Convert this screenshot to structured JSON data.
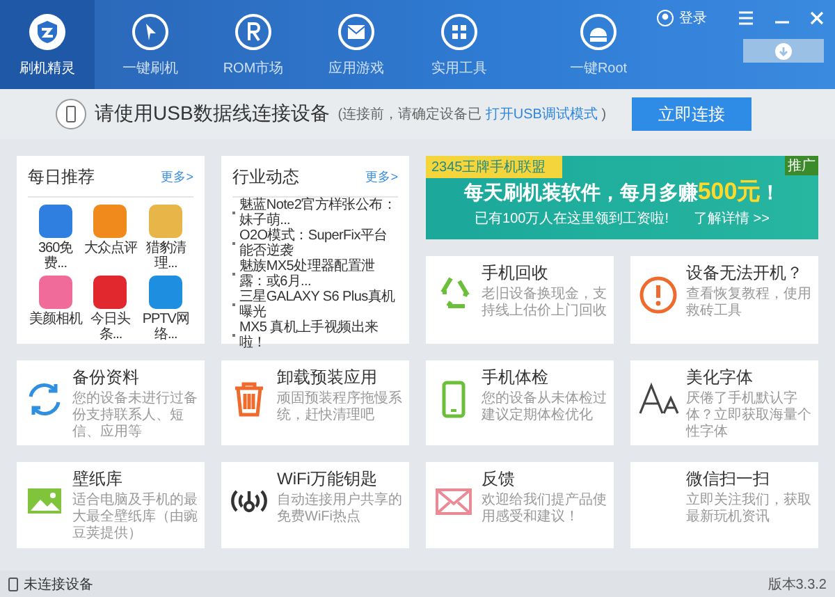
{
  "window": {
    "nav": [
      {
        "kind": "logo",
        "label": "刷机精灵",
        "selected": true
      },
      {
        "kind": "flash",
        "label": "一键刷机",
        "selected": false
      },
      {
        "kind": "rom",
        "label": "ROM市场",
        "selected": false
      },
      {
        "kind": "apps",
        "label": "应用游戏",
        "selected": false
      },
      {
        "kind": "tools",
        "label": "实用工具",
        "selected": false
      },
      {
        "kind": "root",
        "label": "一键Root",
        "selected": false
      }
    ],
    "login": "登录"
  },
  "connect_bar": {
    "title": "请使用USB数据线连接设备",
    "hint_prefix": "(连接前，请确定设备已",
    "hint_link": "打开USB调试模式",
    "hint_suffix": ")",
    "button": "立即连接"
  },
  "daily": {
    "title": "每日推荐",
    "more": "更多>",
    "apps": [
      {
        "name": "360免费...",
        "color": "#2f7fe0"
      },
      {
        "name": "大众点评",
        "color": "#f08a1c"
      },
      {
        "name": "猎豹清理...",
        "color": "#e8b548"
      },
      {
        "name": "美颜相机",
        "color": "#f06a9a"
      },
      {
        "name": "今日头条...",
        "color": "#e0282e"
      },
      {
        "name": "PPTV网络...",
        "color": "#1e8fe0"
      }
    ]
  },
  "news": {
    "title": "行业动态",
    "more": "更多>",
    "items": [
      "魅蓝Note2官方样张公布：妹子萌...",
      "O2O模式：SuperFix平台能否逆袭",
      "魅族MX5处理器配置泄露：或6月...",
      "三星GALAXY S6 Plus真机曝光",
      "MX5 真机上手视频出来啦！"
    ]
  },
  "ad": {
    "tag": "2345王牌手机联盟",
    "badge": "推广",
    "headline_prefix": "每天刷机装软件，每月多赚",
    "headline_highlight": "500元",
    "headline_suffix": "！",
    "sub": "已有100万人在这里领到工资啦!",
    "link": "了解详情 >>"
  },
  "tools": [
    {
      "kind": "recycle",
      "title": "手机回收",
      "desc": "老旧设备换现金，支持线上估价上门回收"
    },
    {
      "kind": "alert",
      "title": "设备无法开机？",
      "desc": "查看恢复教程，使用救砖工具"
    },
    {
      "kind": "backup",
      "title": "备份资料",
      "desc": "您的设备未进行过备份支持联系人、短信、应用等"
    },
    {
      "kind": "trash",
      "title": "卸载预装应用",
      "desc": "顽固预装程序拖慢系统，赶快清理吧"
    },
    {
      "kind": "phone",
      "title": "手机体检",
      "desc": "您的设备从未体检过建议定期体检优化"
    },
    {
      "kind": "font",
      "title": "美化字体",
      "desc": "厌倦了手机默认字体？立即获取海量个性字体"
    },
    {
      "kind": "wallpaper",
      "title": "壁纸库",
      "desc": "适合电脑及手机的最大最全壁纸库（由豌豆荚提供）"
    },
    {
      "kind": "wifi",
      "title": "WiFi万能钥匙",
      "desc": "自动连接用户共享的免费WiFi热点"
    },
    {
      "kind": "mail",
      "title": "反馈",
      "desc": "欢迎给我们提产品使用感受和建议！"
    },
    {
      "kind": "wechat",
      "title": "微信扫一扫",
      "desc": "立即关注我们，获取最新玩机资讯"
    }
  ],
  "status_bar": {
    "device": "未连接设备",
    "version": "版本3.3.2"
  }
}
